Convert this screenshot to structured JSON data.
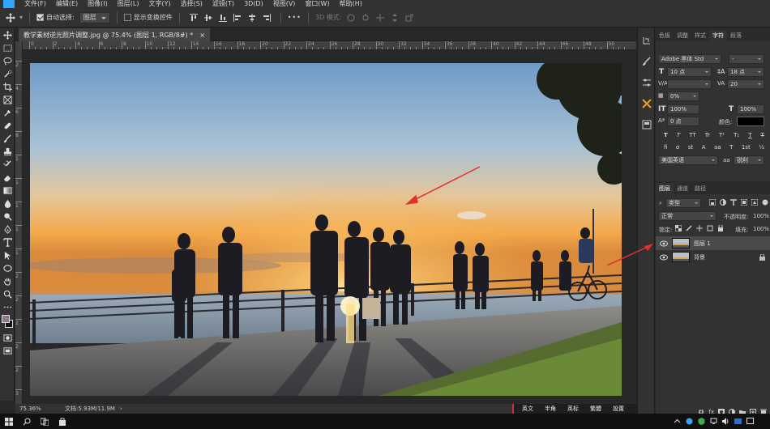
{
  "menubar": {
    "items": [
      "文件(F)",
      "编辑(E)",
      "图像(I)",
      "图层(L)",
      "文字(Y)",
      "选择(S)",
      "滤镜(T)",
      "3D(D)",
      "视图(V)",
      "窗口(W)",
      "帮助(H)"
    ]
  },
  "options": {
    "auto_select_label": "自动选择:",
    "auto_select_value": "图层",
    "show_transform_label": "显示变换控件",
    "mode_3d_label": "3D 模式:",
    "more": "•••"
  },
  "document": {
    "tab_title": "教学素材逆光照片调整.jpg @ 75.4% (图层 1, RGB/8#) *",
    "close": "×"
  },
  "ruler": {
    "h_labels": [
      "0",
      "2",
      "4",
      "6",
      "8",
      "10",
      "12",
      "14",
      "16",
      "18",
      "20",
      "22",
      "24",
      "26",
      "28",
      "30",
      "32",
      "34",
      "36",
      "38",
      "40",
      "42",
      "44",
      "46",
      "48",
      "50"
    ],
    "v_labels": [
      "2",
      "4",
      "6",
      "8",
      "1",
      "1",
      "1",
      "1",
      "1",
      "2",
      "2",
      "2",
      "2",
      "2",
      "3"
    ]
  },
  "status": {
    "zoom": "75.36%",
    "doc_info": "文档:5.93M/11.9M",
    "arrow": "›"
  },
  "ime": {
    "items": [
      "英文",
      "半角",
      "英标",
      "繁體",
      "設置"
    ]
  },
  "character_panel": {
    "tabs": [
      "色板",
      "调整",
      "样式",
      "字符",
      "段落"
    ],
    "active_tab": "字符",
    "font_family": "Adobe 黑体 Std",
    "font_style": "-",
    "font_size": "10 点",
    "leading": "18 点",
    "kerning_label": "V/A",
    "kerning_value": "",
    "tracking": "20",
    "tsume": "0%",
    "vert_scale": "100%",
    "horiz_scale": "100%",
    "baseline": "0 点",
    "color_label": "颜色:",
    "type_styles": [
      "T",
      "T",
      "TT",
      "Tr",
      "T¹",
      "T₁",
      "T",
      "T"
    ],
    "opentype": [
      "fi",
      "σ",
      "st",
      "A",
      "aa",
      "T",
      "1st",
      "½"
    ],
    "language": "美国英语",
    "aa_label": "aa",
    "antialias": "锐利"
  },
  "layers_panel": {
    "tabs": [
      "图层",
      "通道",
      "路径"
    ],
    "active_tab": "图层",
    "filter_kind": "类型",
    "blend_mode": "正常",
    "opacity_label": "不透明度:",
    "opacity": "100%",
    "lock_label": "锁定:",
    "fill_label": "填充:",
    "fill": "100%",
    "layers": [
      {
        "name": "图层 1",
        "selected": true
      },
      {
        "name": "背景",
        "selected": false
      }
    ],
    "bottom_icons": [
      "fx"
    ]
  },
  "colors": {
    "accent": "#31a8ff",
    "panel_bg": "#323232",
    "annotation_red": "#e03030"
  }
}
